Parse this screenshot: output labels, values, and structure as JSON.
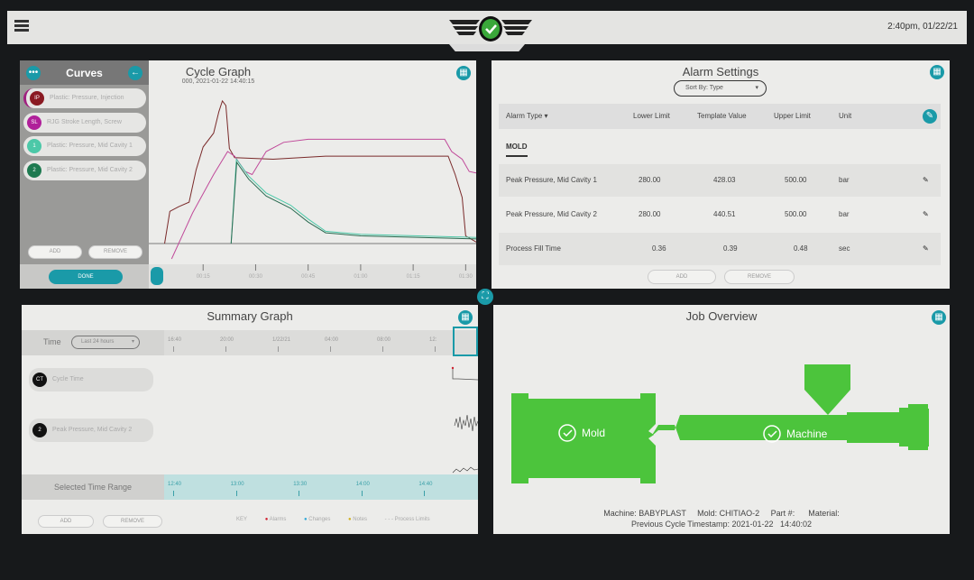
{
  "topbar": {
    "clock": "2:40pm, 01/22/21",
    "menu_icon": "hamburger-icon",
    "logo_icon": "winged-check-logo",
    "status_color": "#3aa83a"
  },
  "cycle": {
    "title": "Cycle Graph",
    "subtitle": "000, 2021-01-22   14:40:15",
    "sidebar": {
      "title": "Curves",
      "curves": [
        {
          "badge": "IP",
          "label": "Plastic: Pressure, Injection",
          "color": "#8a1a22"
        },
        {
          "badge": "SL",
          "label": "RJG Stroke Length, Screw",
          "color": "#b0209a"
        },
        {
          "badge": "1",
          "label": "Plastic: Pressure, Mid Cavity 1",
          "color": "#4cc8a8"
        },
        {
          "badge": "2",
          "label": "Plastic: Pressure, Mid Cavity 2",
          "color": "#1e7a50"
        }
      ],
      "add": "ADD",
      "remove": "REMOVE",
      "done": "DONE"
    }
  },
  "chart_data": {
    "type": "line",
    "title": "Cycle Graph",
    "subtitle": "000, 2021-01-22   14:40:15",
    "x_ticks": [
      "00:15",
      "00:30",
      "00:45",
      "01:00",
      "01:15",
      "01:30"
    ],
    "xlim": [
      0,
      93
    ],
    "ylim": [
      0,
      100
    ],
    "series": [
      {
        "name": "Plastic: Pressure, Injection",
        "color": "#7a2a2a",
        "points": [
          [
            4,
            0
          ],
          [
            5.5,
            21
          ],
          [
            8,
            24
          ],
          [
            11,
            27
          ],
          [
            13,
            48
          ],
          [
            15,
            63
          ],
          [
            18,
            72
          ],
          [
            19.5,
            86
          ],
          [
            20.5,
            93
          ],
          [
            21.5,
            90
          ],
          [
            22.5,
            62
          ],
          [
            24,
            56
          ],
          [
            35,
            55
          ],
          [
            50,
            57
          ],
          [
            85,
            57
          ],
          [
            87,
            45
          ],
          [
            89,
            30
          ],
          [
            90,
            5
          ],
          [
            93,
            1
          ]
        ]
      },
      {
        "name": "RJG Stroke Length, Screw",
        "color": "#c04a9a",
        "points": [
          [
            6,
            -10
          ],
          [
            12,
            20
          ],
          [
            18,
            45
          ],
          [
            22,
            60
          ],
          [
            24,
            57
          ],
          [
            27,
            47
          ],
          [
            29,
            45
          ],
          [
            33,
            60
          ],
          [
            38,
            66
          ],
          [
            45,
            68
          ],
          [
            70,
            68
          ],
          [
            84,
            68
          ],
          [
            86,
            60
          ],
          [
            89,
            55
          ],
          [
            91,
            47
          ],
          [
            93,
            46
          ]
        ]
      },
      {
        "name": "Plastic: Pressure, Mid Cavity 1",
        "color": "#4cc8a8",
        "points": [
          [
            23,
            0
          ],
          [
            24.5,
            55
          ],
          [
            28,
            44
          ],
          [
            33,
            33
          ],
          [
            40,
            25
          ],
          [
            45,
            16
          ],
          [
            50,
            8
          ],
          [
            60,
            6
          ],
          [
            93,
            4
          ]
        ]
      },
      {
        "name": "Plastic: Pressure, Mid Cavity 2",
        "color": "#2a6a50",
        "points": [
          [
            23,
            0
          ],
          [
            24.6,
            53
          ],
          [
            28,
            42
          ],
          [
            33,
            31
          ],
          [
            40,
            23
          ],
          [
            45,
            14
          ],
          [
            50,
            7
          ],
          [
            60,
            5
          ],
          [
            93,
            3
          ]
        ]
      }
    ]
  },
  "alarm": {
    "title": "Alarm Settings",
    "sort_label": "Sort By:",
    "sort_value": "Type",
    "headers": [
      "Alarm Type",
      "Lower Limit",
      "Template Value",
      "Upper Limit",
      "Unit"
    ],
    "group": "MOLD",
    "rows": [
      [
        "Peak Pressure, Mid Cavity 1",
        "280.00",
        "428.03",
        "500.00",
        "bar"
      ],
      [
        "Peak Pressure, Mid Cavity 2",
        "280.00",
        "440.51",
        "500.00",
        "bar"
      ],
      [
        "Process Fill Time",
        "0.36",
        "0.39",
        "0.48",
        "sec"
      ]
    ],
    "add": "ADD",
    "remove": "REMOVE"
  },
  "summary": {
    "title": "Summary Graph",
    "time_label": "Time",
    "time_value": "Last 24 hours",
    "top_ticks": [
      "16:40",
      "20:00",
      "1/22/21",
      "04:00",
      "08:00",
      "12:"
    ],
    "rows": [
      {
        "badge": "CT",
        "label": "Cycle Time"
      },
      {
        "badge": "2",
        "label": "Peak Pressure, Mid Cavity 2"
      }
    ],
    "range_label": "Selected Time Range",
    "range_ticks": [
      "12:40",
      "13:00",
      "13:30",
      "14:00",
      "14:40"
    ],
    "add": "ADD",
    "remove": "REMOVE",
    "key": {
      "label": "KEY",
      "items": [
        {
          "label": "Alarms",
          "color": "#d02030"
        },
        {
          "label": "Changes",
          "color": "#30a8d8"
        },
        {
          "label": "Notes",
          "color": "#d0b020"
        },
        {
          "label": "Process Limits",
          "color": "#cccccc"
        }
      ]
    }
  },
  "job": {
    "title": "Job Overview",
    "mold": "Mold",
    "machine": "Machine",
    "ok_color": "#4cc43c",
    "info1": "Machine: BABYPLAST     Mold: CHITIAO-2     Part #:      Material:",
    "info2": "Previous Cycle Timestamp: 2021-01-22   14:40:02"
  }
}
